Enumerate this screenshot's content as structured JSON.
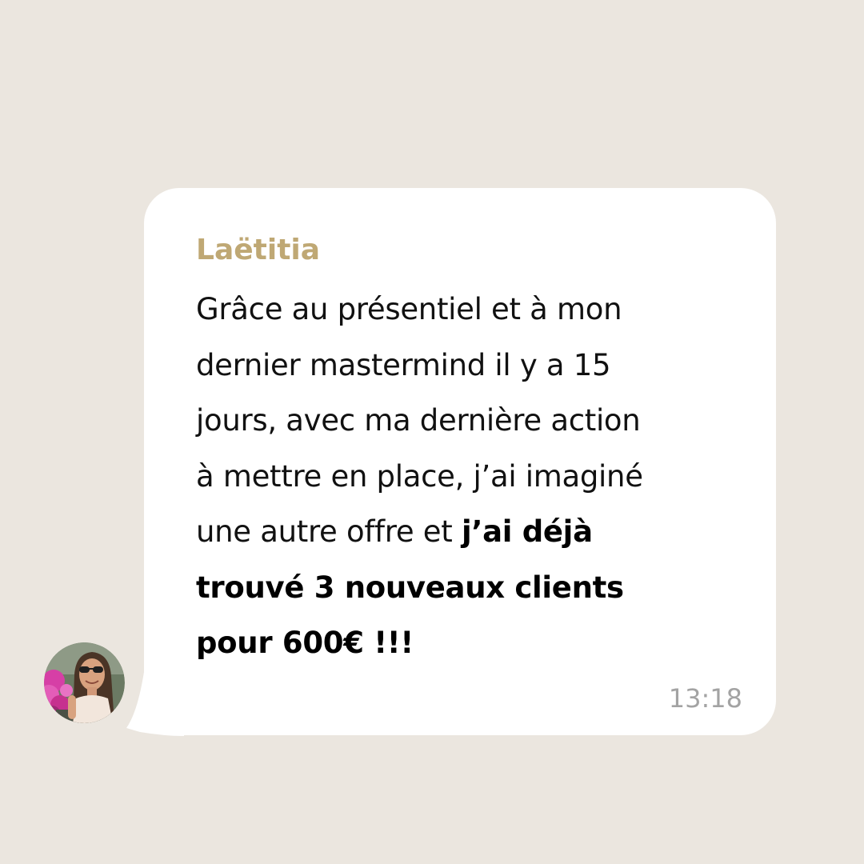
{
  "chat": {
    "sender_name": "Laëtitia",
    "message_lines": [
      "Grâce au présentiel et à mon",
      "dernier mastermind il y a 15",
      "jours, avec ma dernière action",
      "à mettre en place, j’ai imaginé"
    ],
    "line5_normal": "une autre offre et ",
    "line5_bold": "j’ai déjà",
    "line6_bold": "trouvé 3 nouveaux clients",
    "line7_bold": "pour 600€ !!!",
    "timestamp": "13:18",
    "avatar_icon": "user-photo-avatar"
  },
  "colors": {
    "background": "#ebe6df",
    "bubble": "#ffffff",
    "sender_name": "#bfa874",
    "message_text": "#111111",
    "timestamp": "#a3a3a3"
  }
}
